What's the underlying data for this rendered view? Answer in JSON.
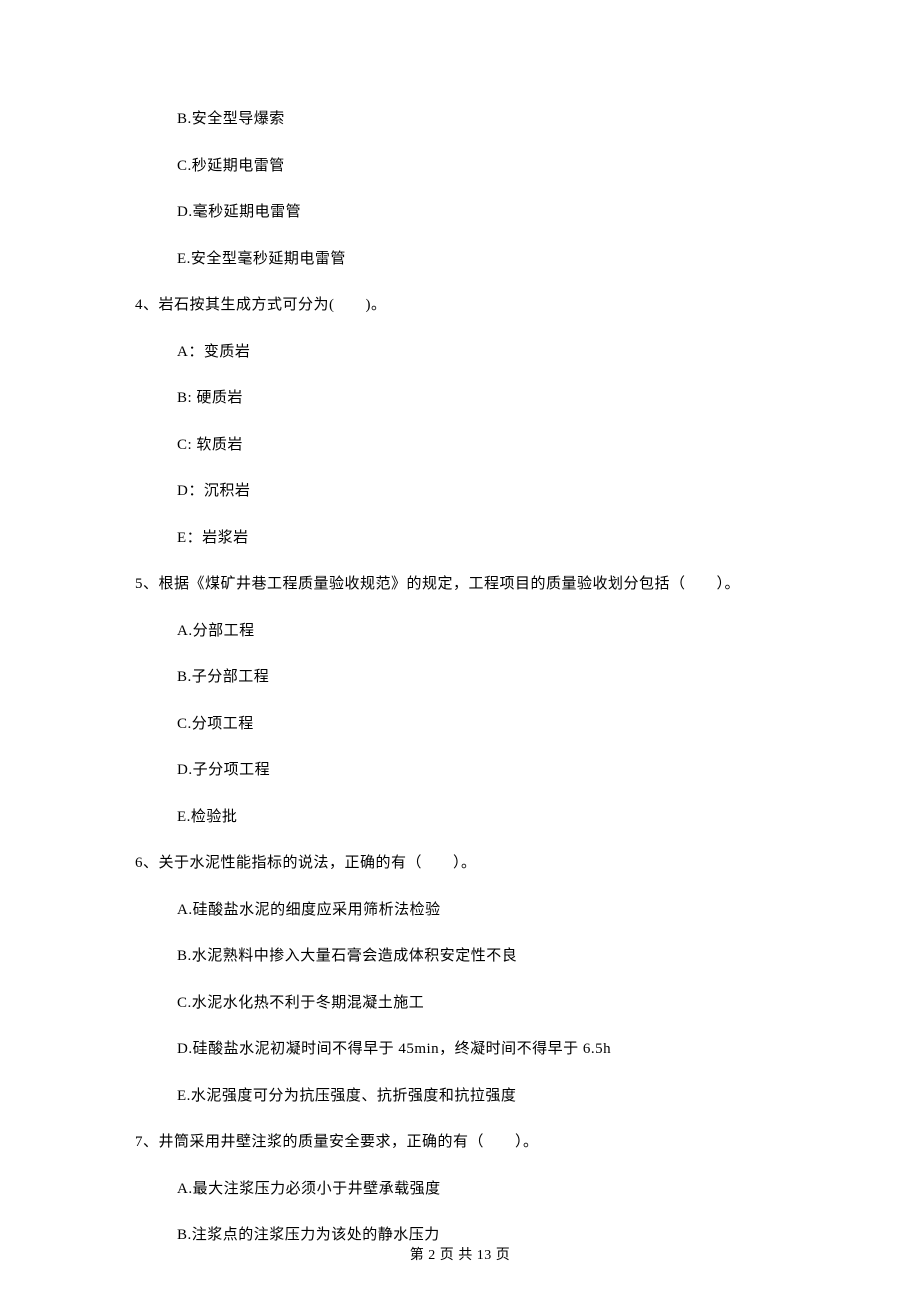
{
  "prev_options": {
    "B": "B.安全型导爆索",
    "C": "C.秒延期电雷管",
    "D": "D.毫秒延期电雷管",
    "E": "E.安全型毫秒延期电雷管"
  },
  "q4": {
    "stem": "4、岩石按其生成方式可分为(　　)。",
    "A": "A：变质岩",
    "B": "B: 硬质岩",
    "C": "C: 软质岩",
    "D": "D：沉积岩",
    "E": "E：岩浆岩"
  },
  "q5": {
    "stem": "5、根据《煤矿井巷工程质量验收规范》的规定，工程项目的质量验收划分包括（　　）。",
    "A": "A.分部工程",
    "B": "B.子分部工程",
    "C": "C.分项工程",
    "D": "D.子分项工程",
    "E": "E.检验批"
  },
  "q6": {
    "stem": "6、关于水泥性能指标的说法，正确的有（　　）。",
    "A": "A.硅酸盐水泥的细度应采用筛析法检验",
    "B": "B.水泥熟料中掺入大量石膏会造成体积安定性不良",
    "C": "C.水泥水化热不利于冬期混凝土施工",
    "D": "D.硅酸盐水泥初凝时间不得早于 45min，终凝时间不得早于 6.5h",
    "E": "E.水泥强度可分为抗压强度、抗折强度和抗拉强度"
  },
  "q7": {
    "stem": "7、井筒采用井壁注浆的质量安全要求，正确的有（　　）。",
    "A": "A.最大注浆压力必须小于井壁承载强度",
    "B": "B.注浆点的注浆压力为该处的静水压力"
  },
  "footer": "第 2 页 共 13 页"
}
